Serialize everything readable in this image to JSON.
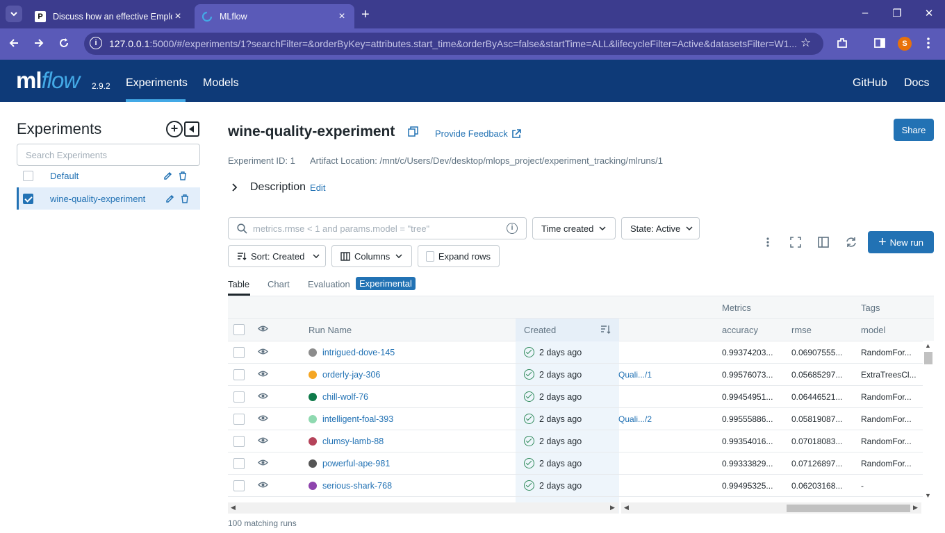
{
  "browser": {
    "tabs": [
      {
        "title": "Discuss how an effective Employ",
        "active": false
      },
      {
        "title": "MLflow",
        "active": true
      }
    ],
    "url_host": "127.0.0.1",
    "url_rest": ":5000/#/experiments/1?searchFilter=&orderByKey=attributes.start_time&orderByAsc=false&startTime=ALL&lifecycleFilter=Active&datasetsFilter=W1...",
    "profile_initial": "S"
  },
  "header": {
    "logo_ml": "ml",
    "logo_flow": "flow",
    "version": "2.9.2",
    "nav": {
      "experiments": "Experiments",
      "models": "Models",
      "github": "GitHub",
      "docs": "Docs"
    }
  },
  "sidebar": {
    "title": "Experiments",
    "search_placeholder": "Search Experiments",
    "experiments": [
      {
        "name": "Default",
        "checked": false
      },
      {
        "name": "wine-quality-experiment",
        "checked": true
      }
    ]
  },
  "main": {
    "title": "wine-quality-experiment",
    "feedback": "Provide Feedback",
    "share": "Share",
    "experiment_id_label": "Experiment ID: 1",
    "artifact_label": "Artifact Location: /mnt/c/Users/Dev/desktop/mlops_project/experiment_tracking/mlruns/1",
    "description_label": "Description",
    "description_edit": "Edit",
    "search_placeholder": "metrics.rmse < 1 and params.model = \"tree\"",
    "time_created": "Time created",
    "state": "State: Active",
    "sort": "Sort: Created",
    "columns": "Columns",
    "expand_rows": "Expand rows",
    "new_run": "New run",
    "view_tabs": {
      "table": "Table",
      "chart": "Chart",
      "evaluation": "Evaluation",
      "experimental": "Experimental"
    },
    "footer": "100 matching runs"
  },
  "table": {
    "groups": {
      "metrics": "Metrics",
      "tags": "Tags"
    },
    "columns": {
      "run_name": "Run Name",
      "created": "Created",
      "accuracy": "accuracy",
      "rmse": "rmse",
      "model": "model"
    },
    "rows": [
      {
        "name": "intrigued-dove-145",
        "color": "#8c8c8c",
        "created": "2 days ago",
        "dataset": "",
        "accuracy": "0.99374203...",
        "rmse": "0.06907555...",
        "model": "RandomFor..."
      },
      {
        "name": "orderly-jay-306",
        "color": "#f5a623",
        "created": "2 days ago",
        "dataset": "Quali.../1",
        "accuracy": "0.99576073...",
        "rmse": "0.05685297...",
        "model": "ExtraTreesCl..."
      },
      {
        "name": "chill-wolf-76",
        "color": "#0f7a4a",
        "created": "2 days ago",
        "dataset": "",
        "accuracy": "0.99454951...",
        "rmse": "0.06446521...",
        "model": "RandomFor..."
      },
      {
        "name": "intelligent-foal-393",
        "color": "#8fd9b0",
        "created": "2 days ago",
        "dataset": "Quali.../2",
        "accuracy": "0.99555886...",
        "rmse": "0.05819087...",
        "model": "RandomFor..."
      },
      {
        "name": "clumsy-lamb-88",
        "color": "#b5435a",
        "created": "2 days ago",
        "dataset": "",
        "accuracy": "0.99354016...",
        "rmse": "0.07018083...",
        "model": "RandomFor..."
      },
      {
        "name": "powerful-ape-981",
        "color": "#555555",
        "created": "2 days ago",
        "dataset": "",
        "accuracy": "0.99333829...",
        "rmse": "0.07126897...",
        "model": "RandomFor..."
      },
      {
        "name": "serious-shark-768",
        "color": "#8e44ad",
        "created": "2 days ago",
        "dataset": "",
        "accuracy": "0.99495325...",
        "rmse": "0.06203168...",
        "model": "-"
      }
    ]
  }
}
